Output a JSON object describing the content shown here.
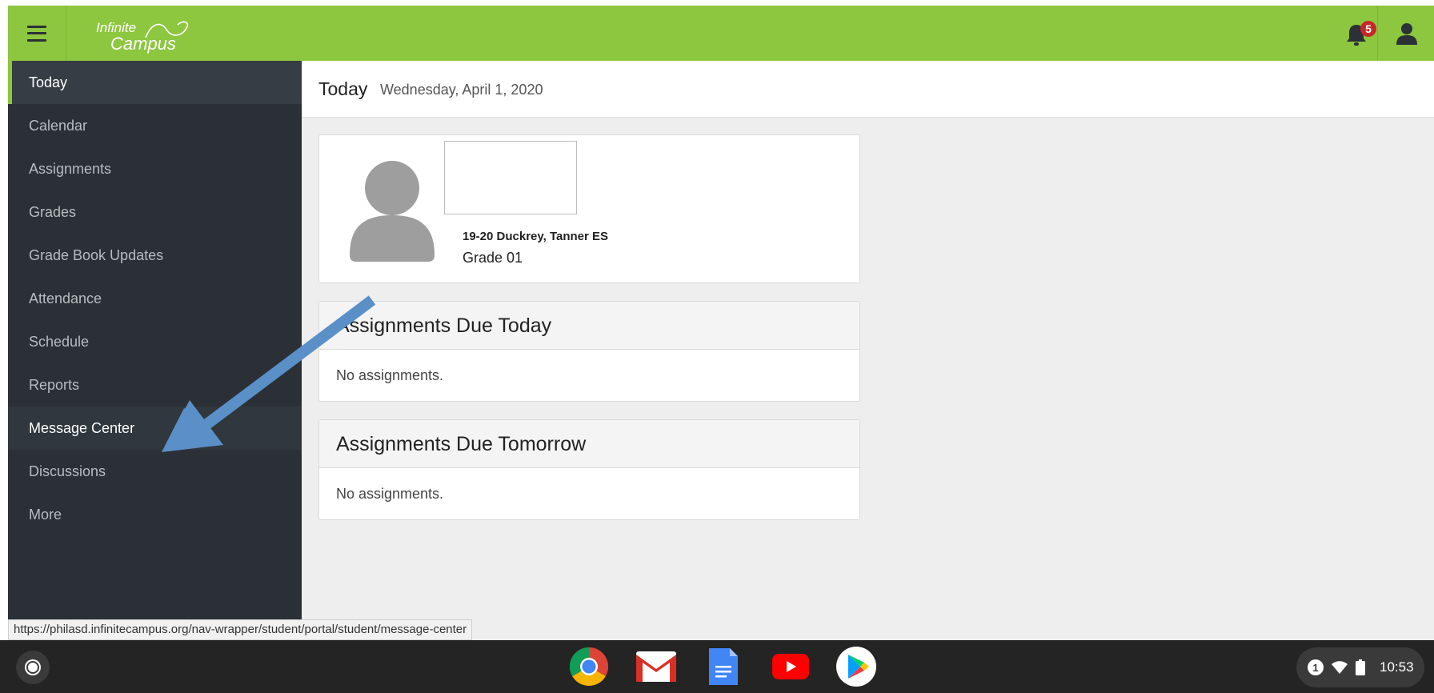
{
  "header": {
    "logo_line1": "Infinite",
    "logo_line2": "Campus",
    "notification_count": "5"
  },
  "sidebar": {
    "items": [
      {
        "label": "Today"
      },
      {
        "label": "Calendar"
      },
      {
        "label": "Assignments"
      },
      {
        "label": "Grades"
      },
      {
        "label": "Grade Book Updates"
      },
      {
        "label": "Attendance"
      },
      {
        "label": "Schedule"
      },
      {
        "label": "Reports"
      },
      {
        "label": "Message Center"
      },
      {
        "label": "Discussions"
      },
      {
        "label": "More"
      }
    ],
    "active": "Today",
    "hovered": "Message Center"
  },
  "page": {
    "title": "Today",
    "date": "Wednesday, April 1, 2020"
  },
  "student": {
    "school": "19-20 Duckrey, Tanner ES",
    "grade": "Grade 01"
  },
  "cards": {
    "today_title": "Assignments Due Today",
    "today_empty": "No assignments.",
    "tomorrow_title": "Assignments Due Tomorrow",
    "tomorrow_empty": "No assignments."
  },
  "status_url": "https://philasd.infinitecampus.org/nav-wrapper/student/portal/student/message-center",
  "shelf": {
    "apps": [
      "chrome-icon",
      "gmail-icon",
      "docs-icon",
      "youtube-icon",
      "play-store-icon"
    ],
    "tray_notification_count": "1",
    "time": "10:53"
  },
  "colors": {
    "header_green": "#8dc63f",
    "sidebar_bg": "#2a3036",
    "annotation_arrow": "#5b8fc7"
  }
}
